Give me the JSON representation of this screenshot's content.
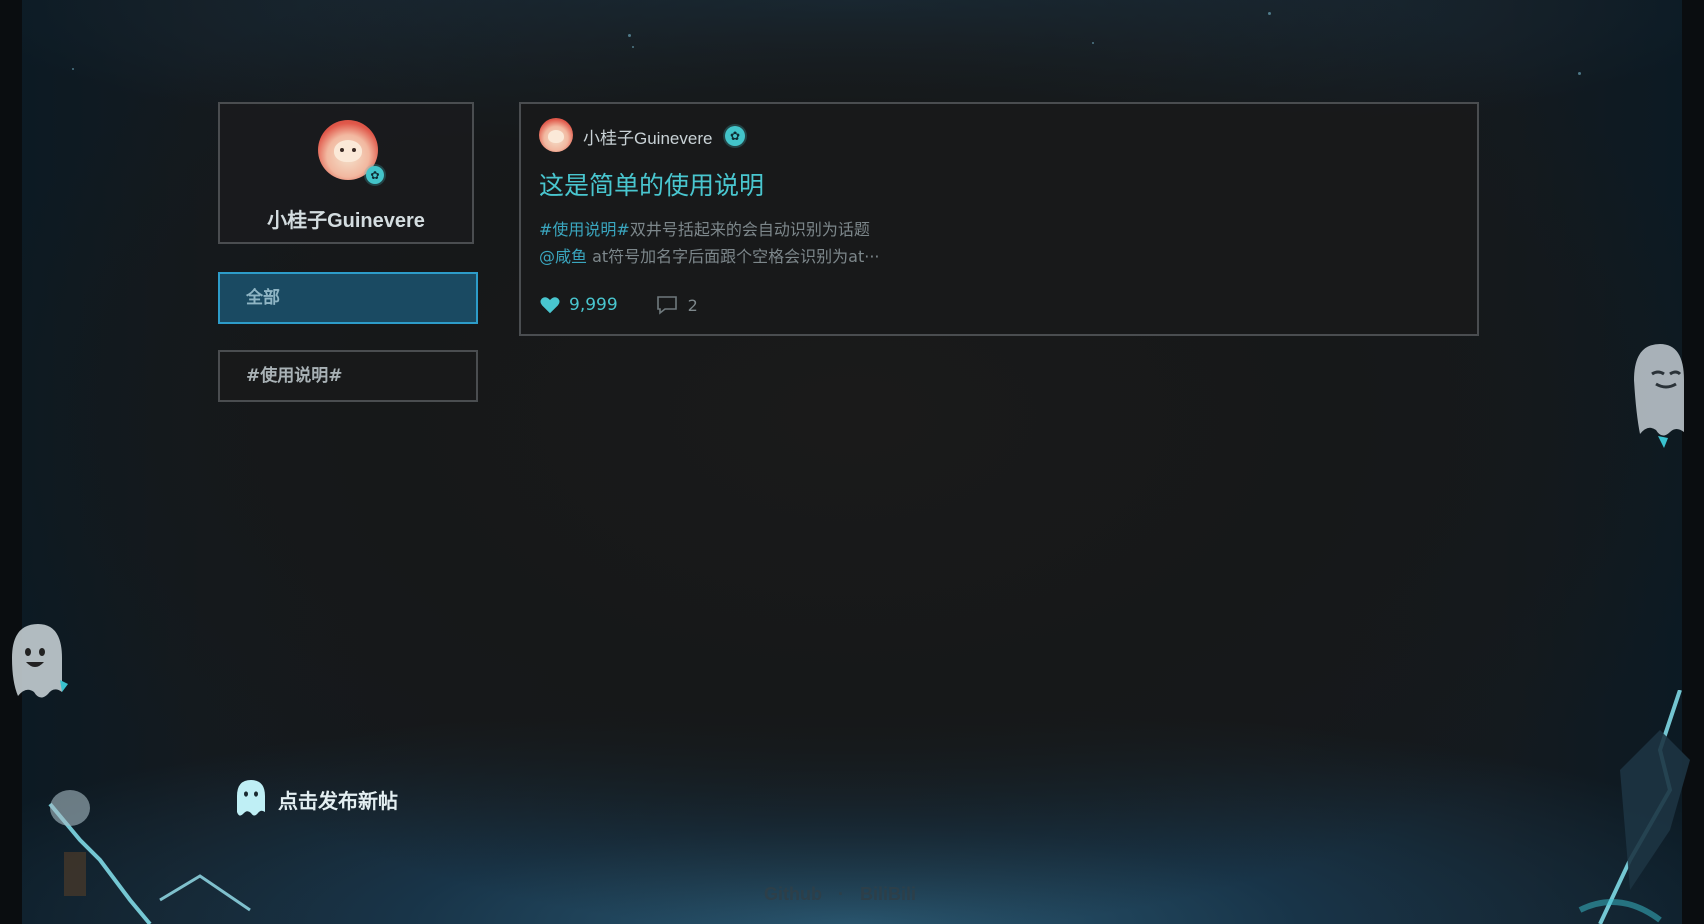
{
  "profile": {
    "name": "小桂子Guinevere",
    "verified_mark": "✿"
  },
  "filters": [
    {
      "label": "全部",
      "active": true
    },
    {
      "label": "#使用说明#",
      "active": false
    }
  ],
  "post": {
    "author": "小桂子Guinevere",
    "title": "这是简单的使用说明",
    "line1_tag": "#使用说明#",
    "line1_text": "双井号括起来的会自动识别为话题",
    "line2_mention": "@咸鱼",
    "line2_text": " at符号加名字后面跟个空格会识别为at···",
    "likes": "9,999",
    "comments": "2"
  },
  "new_post": {
    "label": "点击发布新帖",
    "icon": "ghost-icon"
  },
  "footer": {
    "github": "Github",
    "separator": "·",
    "bilibili": "BiliBili"
  },
  "colors": {
    "accent": "#49c6cf",
    "active_filter_bg": "#1a4a62",
    "active_filter_border": "#2d9cc9",
    "card_border": "#4a4d50"
  }
}
